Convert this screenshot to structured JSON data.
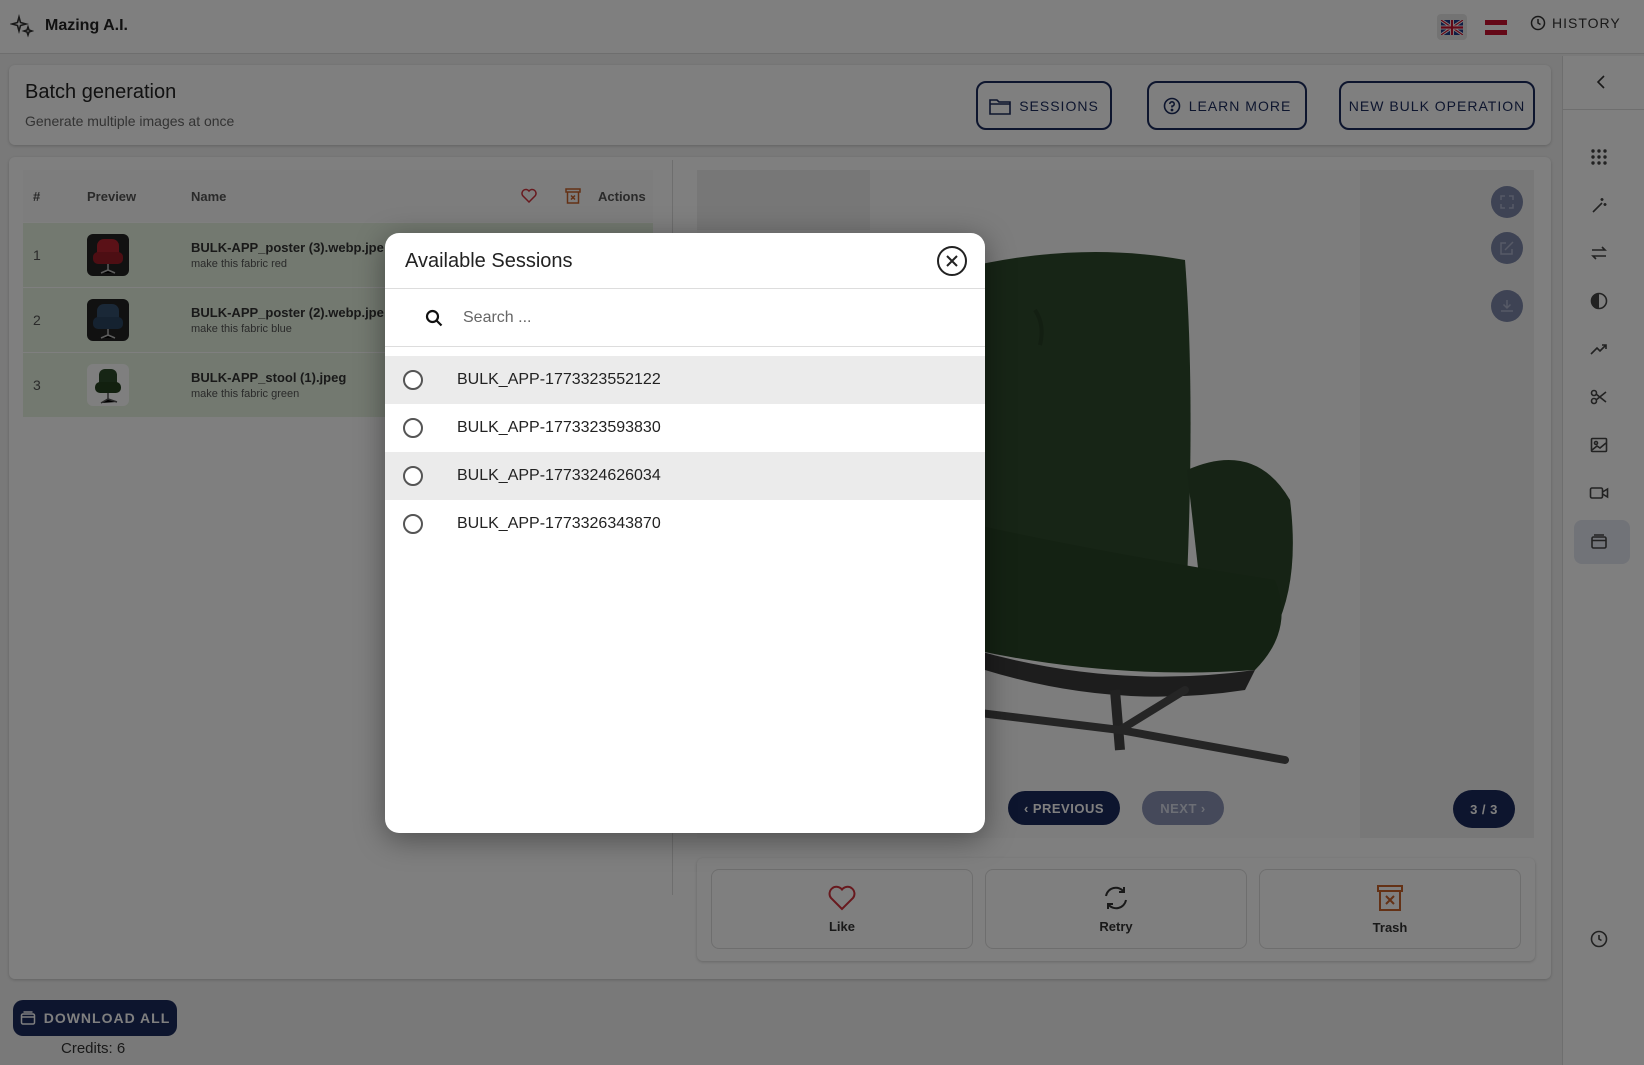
{
  "app": {
    "title": "Mazing A.I.",
    "history_label": "HISTORY"
  },
  "header": {
    "title": "Batch generation",
    "subtitle": "Generate multiple images at once",
    "sessions_label": "SESSIONS",
    "learn_more_label": "LEARN MORE",
    "new_bulk_label": "NEW BULK OPERATION"
  },
  "table": {
    "columns": {
      "num": "#",
      "preview": "Preview",
      "name": "Name",
      "actions": "Actions"
    },
    "rows": [
      {
        "num": "1",
        "name": "BULK-APP_poster (3).webp.jpe",
        "prompt": "make this fabric red",
        "color": "#b4232f"
      },
      {
        "num": "2",
        "name": "BULK-APP_poster (2).webp.jpe",
        "prompt": "make this fabric blue",
        "color": "#35506e"
      },
      {
        "num": "3",
        "name": "BULK-APP_stool (1).jpeg",
        "prompt": "make this fabric green",
        "color": "#2c4a2a"
      }
    ]
  },
  "preview": {
    "prev_label": "PREVIOUS",
    "next_label": "NEXT",
    "counter": "3 / 3"
  },
  "actions": {
    "like": "Like",
    "retry": "Retry",
    "trash": "Trash"
  },
  "footer": {
    "download_all": "DOWNLOAD ALL",
    "credits": "Credits: 6"
  },
  "modal": {
    "title": "Available Sessions",
    "search_placeholder": "Search ...",
    "sessions": [
      "BULK_APP-1773323552122",
      "BULK_APP-1773323593830",
      "BULK_APP-1773324626034",
      "BULK_APP-1773326343870"
    ]
  },
  "colors": {
    "primary": "#1b2a5c",
    "like": "#d0323c",
    "trash": "#c9622a",
    "row_bg": "#e6f3e0"
  }
}
